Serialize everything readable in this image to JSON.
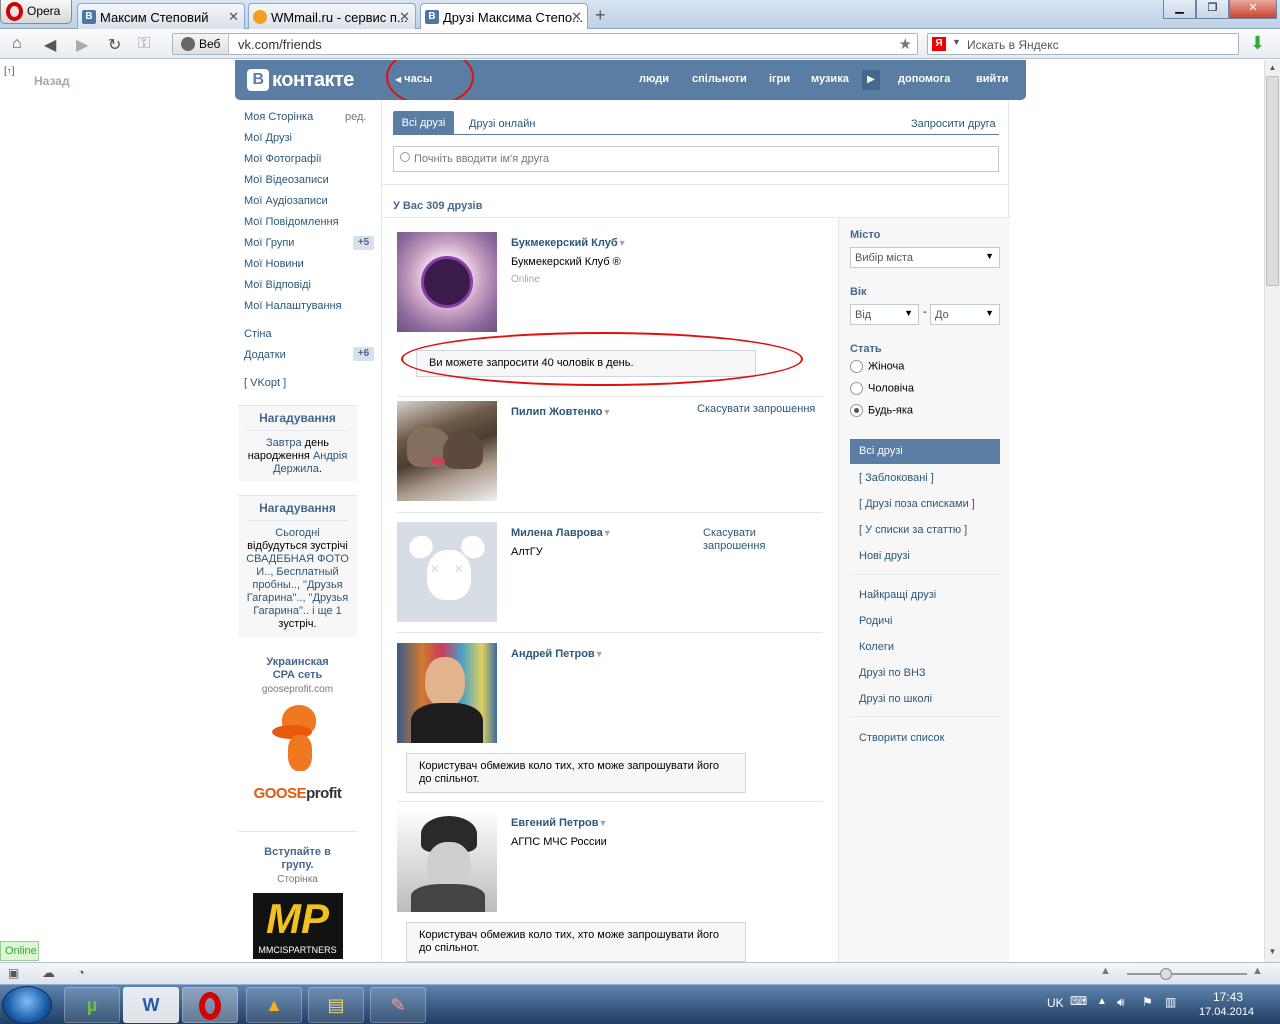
{
  "browser": {
    "opera_label": "Opera",
    "tabs": [
      {
        "title": "Максим Степовий",
        "fav": "В"
      },
      {
        "title": "WMmail.ru - сервис п...",
        "fav": ""
      },
      {
        "title": "Друзі Максима Степо...",
        "fav": "В"
      }
    ],
    "web_label": "Веб",
    "url": "vk.com/friends",
    "search_placeholder": "Искать в Яндекс",
    "search_engine": "Я"
  },
  "vk": {
    "back_icon": "[↑]",
    "back_label": "Назад",
    "logo_letter": "В",
    "logo_text": "контакте",
    "clock_label": "часы",
    "nav": [
      "люди",
      "спільноти",
      "ігри",
      "музика",
      "допомога",
      "вийти"
    ],
    "left_menu": [
      {
        "label": "Моя Сторінка",
        "extra": "ред."
      },
      {
        "label": "Мої Друзі"
      },
      {
        "label": "Мої Фотографії"
      },
      {
        "label": "Мої Відеозаписи"
      },
      {
        "label": "Мої Аудіозаписи"
      },
      {
        "label": "Мої Повідомлення"
      },
      {
        "label": "Мої Групи",
        "count": "+5"
      },
      {
        "label": "Мої Новини"
      },
      {
        "label": "Мої Відповіді"
      },
      {
        "label": "Мої Налаштування"
      }
    ],
    "left_menu2": [
      {
        "label": "Стіна"
      },
      {
        "label": "Додатки",
        "count": "+6"
      },
      {
        "label": "[ VKopt ]"
      }
    ],
    "reminder1": {
      "title": "Нагадування",
      "l1a": "Завтра",
      "l1b": " день",
      "l2a": "народження ",
      "l2b": "Андрія",
      "l3": "Держила",
      "l3b": "."
    },
    "reminder2": {
      "title": "Нагадування",
      "lines": [
        "Сьогодні",
        "відбудуться зустрічі",
        "СВАДЕБНАЯ ФОТО",
        "И.., Бесплатный",
        "пробны.., \"Друзья",
        "Гагарина\".., \"Друзья",
        "Гагарина\".. і ще 1",
        "зустріч."
      ]
    },
    "ad1": {
      "t1": "Украинская",
      "t2": "СРА сеть",
      "site": "gooseprofit.com",
      "logo1": "GOOSE",
      "logo2": "profit"
    },
    "ad2": {
      "t1": "Вступайте в",
      "t2": "групу.",
      "sub": "Сторінка",
      "logo": "MP",
      "logo_sub": "MMCISPARTNERS"
    }
  },
  "friends": {
    "tab_all": "Всі друзі",
    "tab_online": "Друзі онлайн",
    "invite": "Запросити друга",
    "search_placeholder": "Почніть вводити ім'я друга",
    "count_text": "У Вас 309 друзів",
    "dd_glyph": "▼",
    "items": [
      {
        "name": "Букмекерский Клуб",
        "sub": "Букмекерский Клуб ®",
        "online": "Online"
      },
      {
        "name": "Пилип Жовтенко",
        "cancel": "Скасувати запрошення"
      },
      {
        "name": "Милена Лаврова",
        "sub": "АлтГУ",
        "cancel1": "Скасувати",
        "cancel2": "запрошення"
      },
      {
        "name": "Андрей Петров"
      },
      {
        "name": "Евгений Петров",
        "sub": "АГПС МЧС России"
      }
    ],
    "invite_limit_msg": "Ви можете запросити 40 чоловік в день.",
    "restrict_msg1": "Користувач обмежив коло тих, хто може запрошувати його",
    "restrict_msg2": "до спільнот."
  },
  "filter": {
    "city_label": "Місто",
    "city_placeholder": "Вибір міста",
    "age_label": "Вік",
    "age_from": "Від",
    "age_to": "До",
    "age_dash": "-",
    "sex_label": "Стать",
    "sex_options": [
      "Жіноча",
      "Чоловіча",
      "Будь-яка"
    ],
    "lists_active": "Всі друзі",
    "lists": [
      "[ Заблоковані ]",
      "[ Друзі поза списками ]",
      "[ У списки за статтю ]",
      "Нові друзі",
      "Найкращі друзі",
      "Родичі",
      "Колеги",
      "Друзі по ВНЗ",
      "Друзі по школі",
      "Створити список"
    ]
  },
  "status": {
    "online": "Online"
  },
  "taskbar": {
    "lang": "UK",
    "time": "17:43",
    "date": "17.04.2014"
  }
}
